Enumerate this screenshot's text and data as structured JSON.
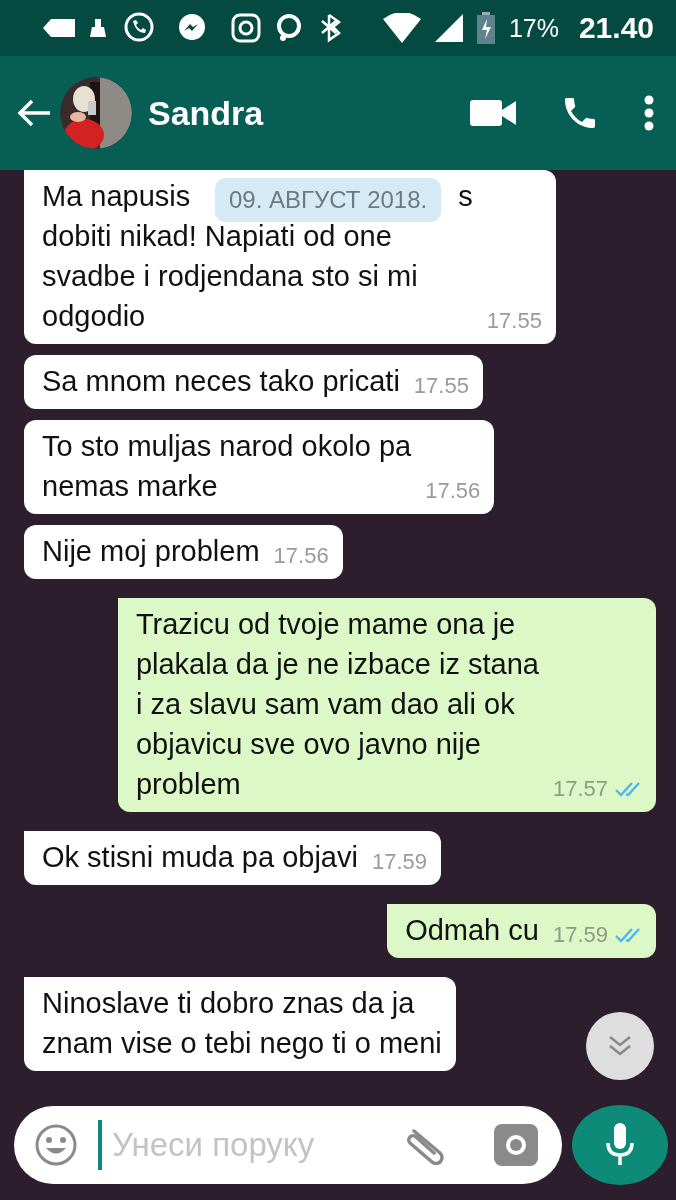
{
  "status_bar": {
    "battery": "17%",
    "time": "21.40"
  },
  "header": {
    "contact_name": "Sandra"
  },
  "date_badge": "09. АВГУСТ 2018.",
  "messages": [
    {
      "kind": "received",
      "first_line_parts": [
        "Ma napusis",
        "s"
      ],
      "text": "dobiti nikad! Napiati od one\nsvadbe i rodjendana sto si mi\nodgodio",
      "time": "17.55"
    },
    {
      "kind": "received",
      "text": "Sa mnom neces tako pricati",
      "time": "17.55"
    },
    {
      "kind": "received",
      "text": "To sto muljas narod okolo pa\nnemas marke",
      "time": "17.56"
    },
    {
      "kind": "received",
      "text": "Nije moj problem",
      "time": "17.56"
    },
    {
      "kind": "sent",
      "text": "Trazicu od tvoje mame ona je\nplakala da je ne izbace iz stana\ni za slavu sam vam dao ali ok\nobjavicu sve ovo javno nije\nproblem",
      "time": "17.57",
      "read": true
    },
    {
      "kind": "received",
      "text": "Ok stisni muda pa objavi",
      "time": "17.59"
    },
    {
      "kind": "sent",
      "text": "Odmah cu",
      "time": "17.59",
      "read": true
    },
    {
      "kind": "received",
      "text": "Ninoslave ti dobro znas da ja\nznam vise o tebi nego ti o meni"
    }
  ],
  "composer": {
    "placeholder": "Унеси поруку"
  }
}
